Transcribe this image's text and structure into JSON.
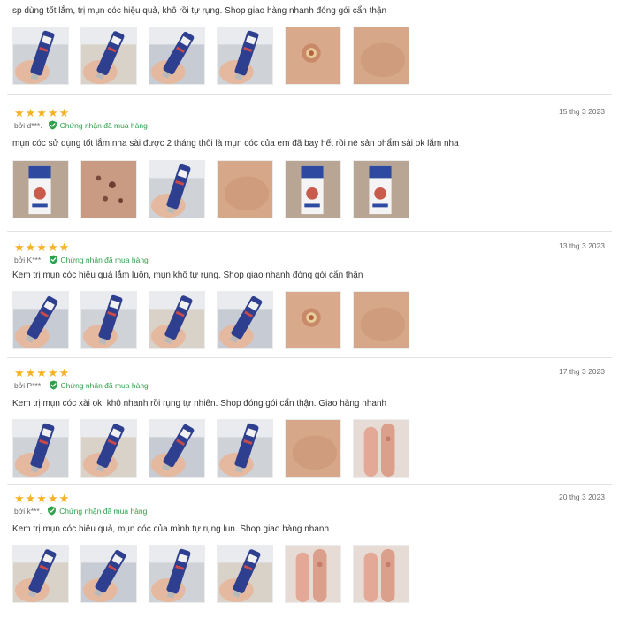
{
  "reviews": [
    {
      "stars": "★★★★★",
      "show_header": false,
      "author": "",
      "verified_label": "",
      "date": "",
      "comment": "sp dùng tốt lắm, trị mụn cóc hiệu quả, khô rồi tự rụng. Shop giao hàng nhanh đóng gói cẩn thận",
      "photos": [
        "tube",
        "tube",
        "tube",
        "tube",
        "skin-wart",
        "skin"
      ]
    },
    {
      "stars": "★★★★★",
      "show_header": true,
      "author": "bởi d***.",
      "verified_label": "Chứng nhận đã mua hàng",
      "date": "15 thg 3 2023",
      "comment": "mụn cóc sử dụng tốt lắm nha sài được 2 tháng thôi là mụn cóc của em đã bay hết rồi nè sản phẩm sài ok lắm nha",
      "photos": [
        "box",
        "skin-spots",
        "tube",
        "skin",
        "box",
        "box"
      ]
    },
    {
      "stars": "★★★★★",
      "show_header": true,
      "author": "bởi K***.",
      "verified_label": "Chứng nhận đã mua hàng",
      "date": "13 thg 3 2023",
      "comment": "Kem trị mụn cóc hiệu quả lắm luôn, mụn khô tự rụng. Shop giao nhanh đóng gói cẩn thận",
      "photos": [
        "tube",
        "tube",
        "tube",
        "tube",
        "skin-wart",
        "skin"
      ]
    },
    {
      "stars": "★★★★★",
      "show_header": true,
      "author": "bởi P***.",
      "verified_label": "Chứng nhận đã mua hàng",
      "date": "17 thg 3 2023",
      "comment": "Kem trị mụn cóc xài ok, khô nhanh rồi rụng tự nhiên. Shop đóng gói cẩn thận. Giao hàng nhanh",
      "photos": [
        "tube",
        "tube",
        "tube",
        "tube",
        "skin",
        "finger"
      ]
    },
    {
      "stars": "★★★★★",
      "show_header": true,
      "author": "bởi k***.",
      "verified_label": "Chứng nhận đã mua hàng",
      "date": "20 thg 3 2023",
      "comment": "Kem trị mụn cóc hiệu quả, mụn cóc của mình tự rụng lun. Shop giao hàng nhanh",
      "photos": [
        "tube",
        "tube",
        "tube",
        "tube",
        "finger",
        "finger"
      ]
    }
  ],
  "colors": {
    "star": "#f5b324",
    "verified": "#2fa14a",
    "text": "#333333",
    "meta": "#6b6b6b",
    "divider": "#e3e3e3"
  },
  "icons": {
    "verified": "shield-check-icon",
    "rating": "star-icon"
  }
}
